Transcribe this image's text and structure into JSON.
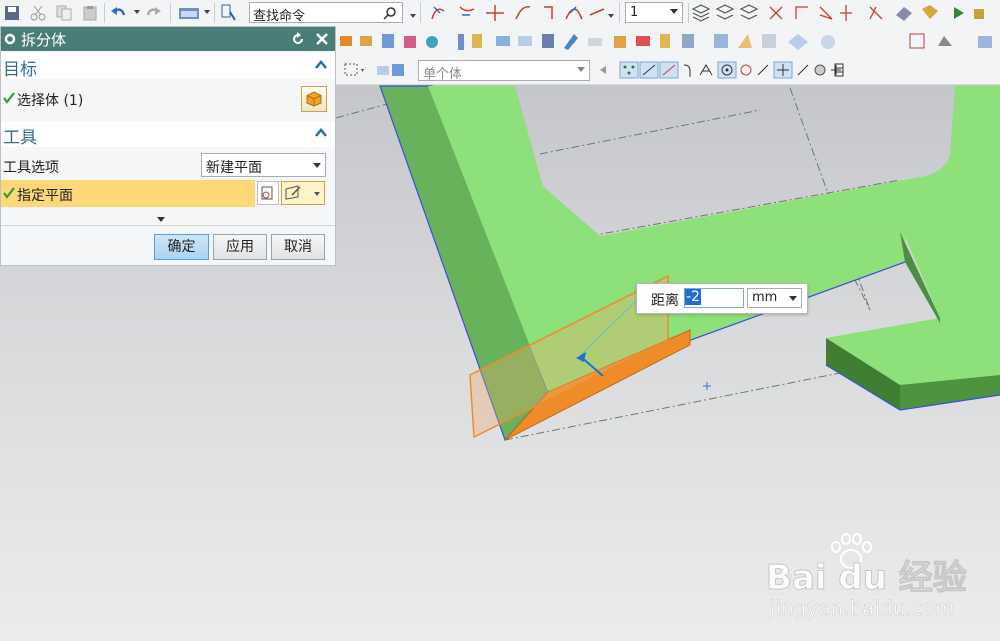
{
  "toolbar_top": {
    "search_placeholder": "查找命令",
    "layer_value": "1"
  },
  "toolbar_bottom": {
    "filter_value": "单个体"
  },
  "dialog": {
    "title": "拆分体",
    "target_section": {
      "title": "目标",
      "select_body_label": "选择体 (1)"
    },
    "tool_section": {
      "title": "工具",
      "tool_option_label": "工具选项",
      "tool_option_value": "新建平面",
      "specify_plane_label": "指定平面"
    },
    "buttons": {
      "ok": "确定",
      "apply": "应用",
      "cancel": "取消"
    }
  },
  "distance_popup": {
    "label": "距离",
    "value": "-2",
    "unit": "mm"
  },
  "watermark": {
    "brand": "Bai du 经验",
    "url": "jingyan.baidu.com"
  },
  "colors": {
    "dialog_title_bg": "#4a7d78",
    "section_title": "#2f6e94",
    "highlight_row": "#fdd879",
    "model_face": "#8ee07a",
    "model_side": "#4d9340",
    "plane_orange": "#ee8c2a"
  }
}
